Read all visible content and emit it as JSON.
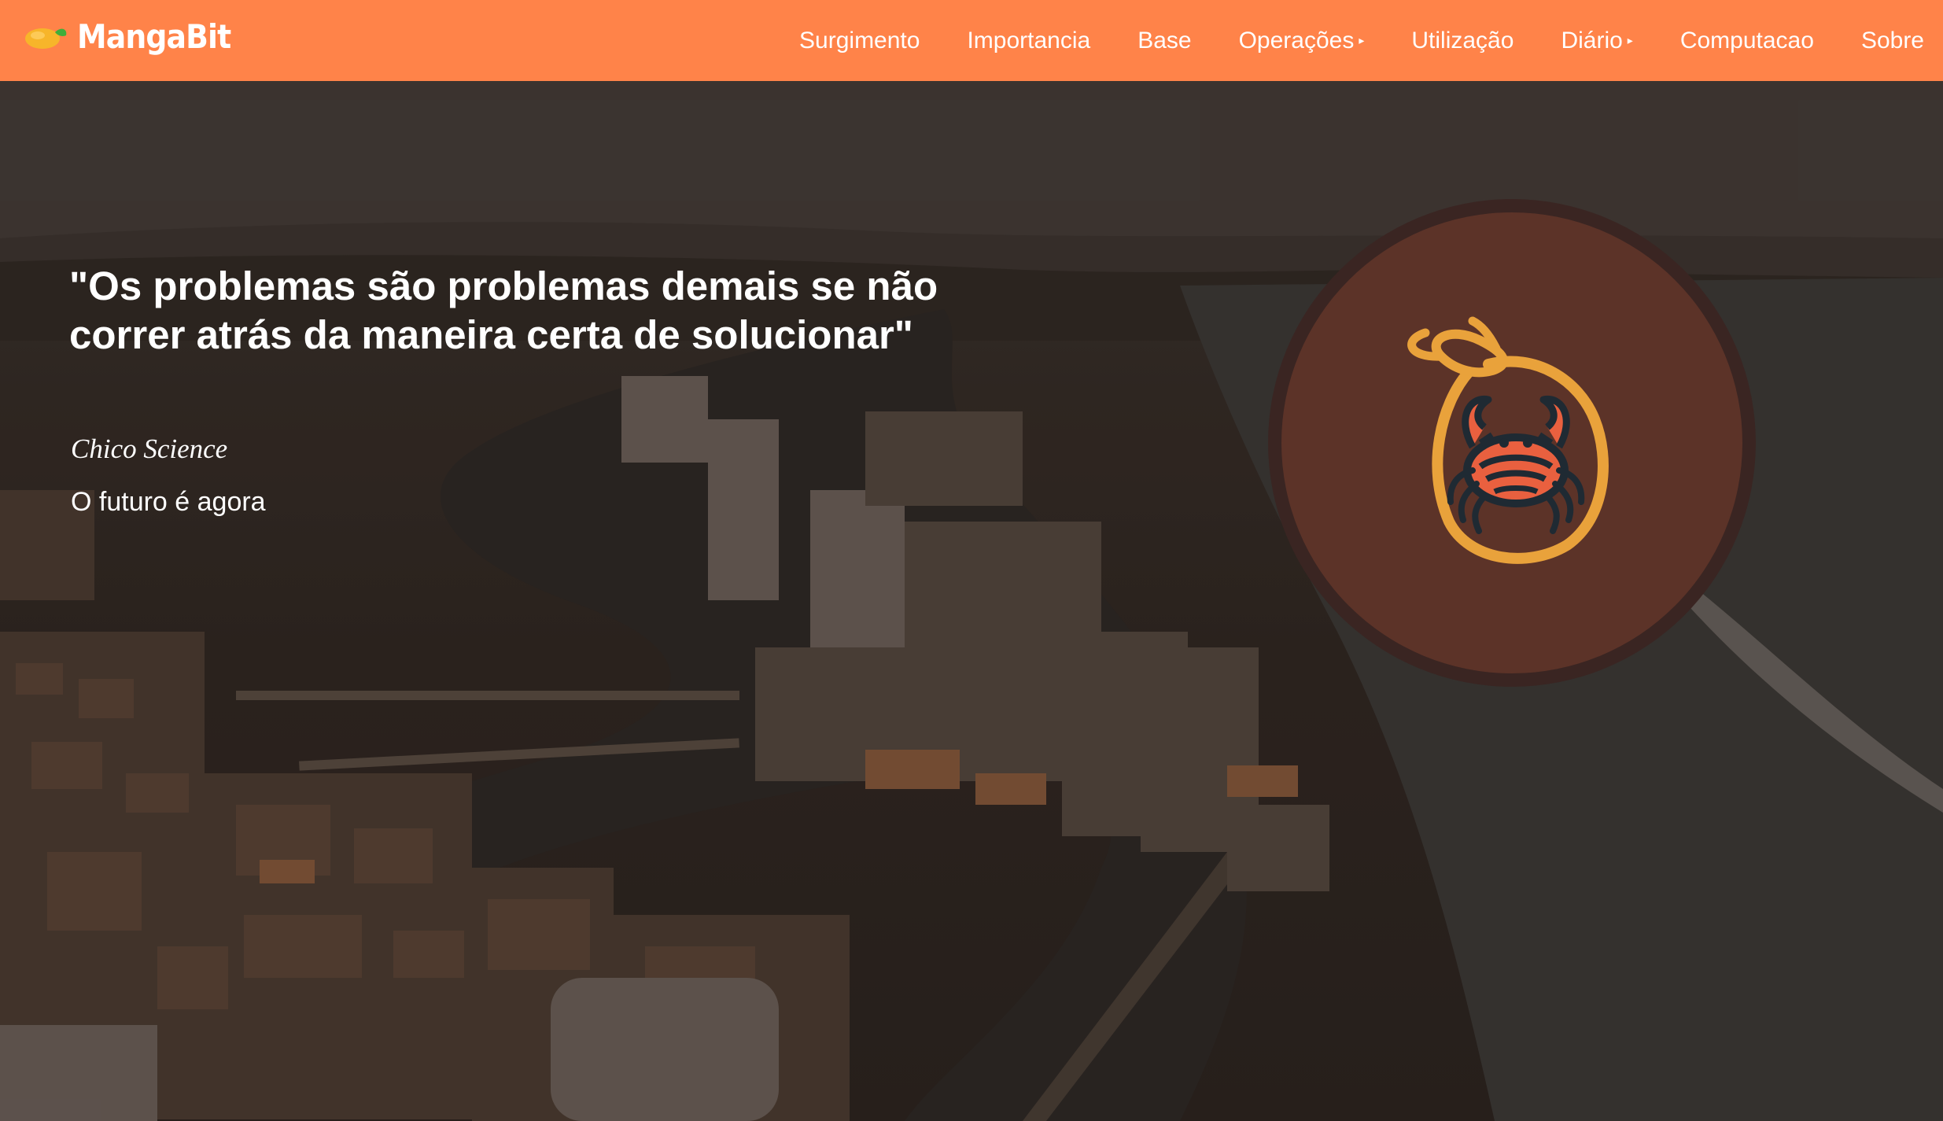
{
  "brand": {
    "name": "MangaBit",
    "logo_icon": "mango-icon"
  },
  "nav": {
    "items": [
      {
        "label": "Surgimento",
        "dropdown": false
      },
      {
        "label": "Importancia",
        "dropdown": false
      },
      {
        "label": "Base",
        "dropdown": false
      },
      {
        "label": "Operações",
        "dropdown": true
      },
      {
        "label": "Utilização",
        "dropdown": false
      },
      {
        "label": "Diário",
        "dropdown": true
      },
      {
        "label": "Computacao",
        "dropdown": false
      },
      {
        "label": "Sobre",
        "dropdown": false
      }
    ]
  },
  "hero": {
    "quote": "\"Os problemas são problemas demais se não correr atrás da maneira certa de solucionar\"",
    "author": "Chico Science",
    "tagline": "O futuro é agora",
    "emblem_icon": "crab-mango-icon"
  },
  "colors": {
    "navbar": "#ff8349",
    "badge": "#5c3328",
    "emblem_outline": "#e9a23b",
    "crab_accent": "#e9603f"
  }
}
